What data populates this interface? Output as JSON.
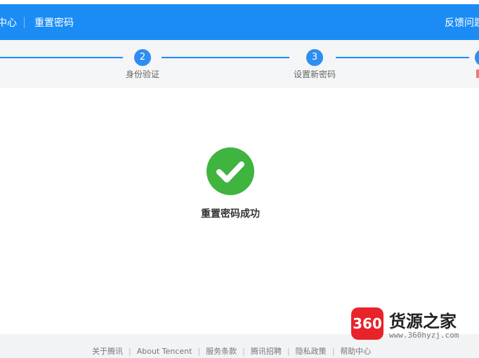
{
  "header": {
    "left_crumb": "中心",
    "title": "重置密码",
    "feedback": "反馈问题"
  },
  "steps": [
    {
      "number": "2",
      "label": "身份验证"
    },
    {
      "number": "3",
      "label": "设置新密码"
    }
  ],
  "result": {
    "message": "重置密码成功"
  },
  "footer": {
    "links": [
      "关于腾讯",
      "About Tencent",
      "服务条款",
      "腾讯招聘",
      "隐私政策",
      "帮助中心"
    ]
  },
  "watermark": {
    "badge": "360",
    "title": "货源之家",
    "url": "www.360hyzj.com"
  },
  "colors": {
    "header": "#1c8cf5",
    "success": "#3fb43f",
    "watermark_badge": "#e8232a"
  }
}
